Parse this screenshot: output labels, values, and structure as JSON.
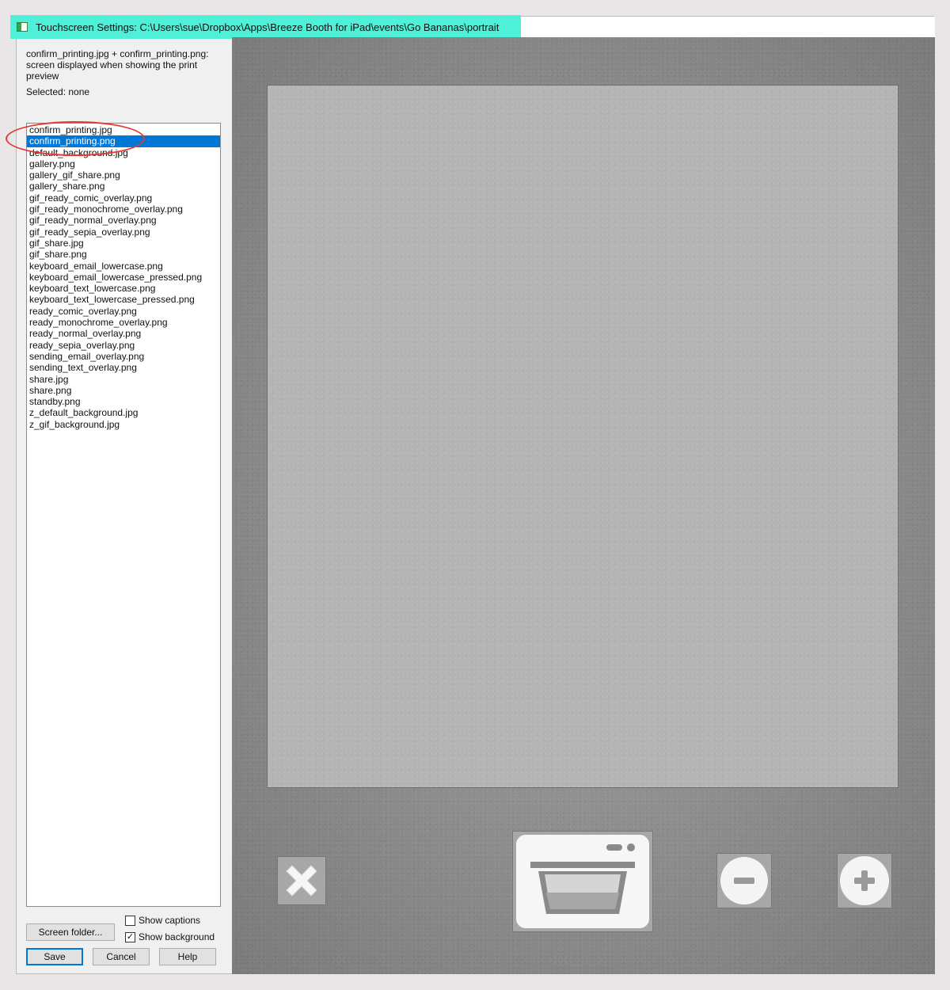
{
  "window": {
    "title": "Touchscreen Settings: C:\\Users\\sue\\Dropbox\\Apps\\Breeze Booth for iPad\\events\\Go Bananas\\portrait"
  },
  "left_panel": {
    "description": "confirm_printing.jpg + confirm_printing.png: screen displayed when showing the print preview",
    "selected_text": "Selected: none",
    "files": [
      "confirm_printing.jpg",
      "confirm_printing.png",
      "default_background.jpg",
      "gallery.png",
      "gallery_gif_share.png",
      "gallery_share.png",
      "gif_ready_comic_overlay.png",
      "gif_ready_monochrome_overlay.png",
      "gif_ready_normal_overlay.png",
      "gif_ready_sepia_overlay.png",
      "gif_share.jpg",
      "gif_share.png",
      "keyboard_email_lowercase.png",
      "keyboard_email_lowercase_pressed.png",
      "keyboard_text_lowercase.png",
      "keyboard_text_lowercase_pressed.png",
      "ready_comic_overlay.png",
      "ready_monochrome_overlay.png",
      "ready_normal_overlay.png",
      "ready_sepia_overlay.png",
      "sending_email_overlay.png",
      "sending_text_overlay.png",
      "share.jpg",
      "share.png",
      "standby.png",
      "z_default_background.jpg",
      "z_gif_background.jpg"
    ],
    "selected_index": 1,
    "screen_folder_label": "Screen folder...",
    "show_captions_label": "Show captions",
    "show_captions_checked": false,
    "show_background_label": "Show background",
    "show_background_checked": true,
    "save_label": "Save",
    "cancel_label": "Cancel",
    "help_label": "Help"
  },
  "preview": {
    "icons": [
      "close-x-icon",
      "printer-icon",
      "minus-icon",
      "plus-icon"
    ]
  },
  "colors": {
    "title_highlight": "#4ef0d8",
    "list_selection": "#0078d7",
    "annotation": "#e53935",
    "preview_bg": "#8c8c8c",
    "photo_area": "#b4b4b4"
  }
}
